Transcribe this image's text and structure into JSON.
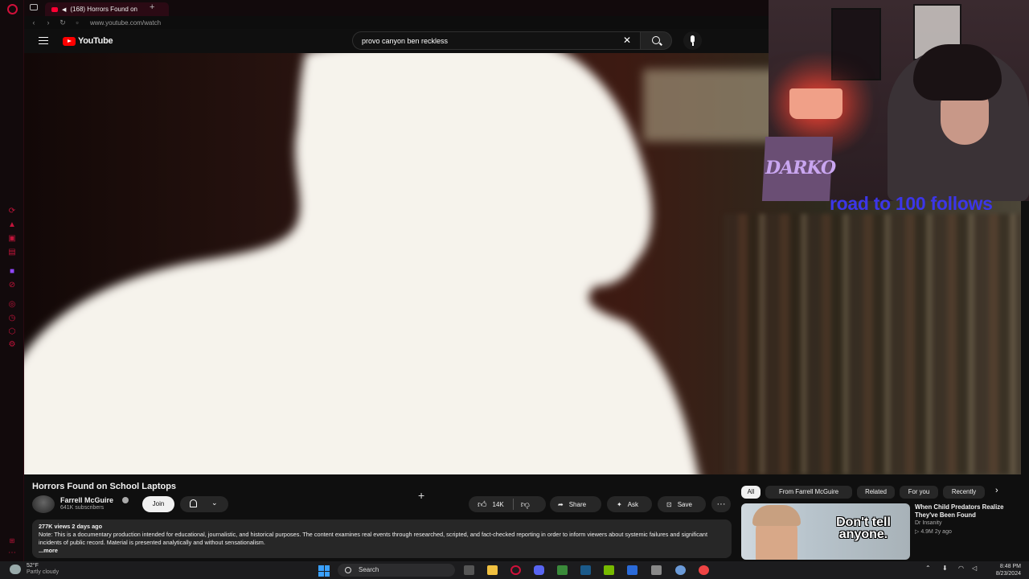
{
  "browser": {
    "tab_title": "(168) Horrors Found on",
    "new_tab_label": "+",
    "url": "www.youtube.com/watch"
  },
  "youtube": {
    "logo_text": "YouTube",
    "search_value": "provo canyon ben reckless"
  },
  "overlay": {
    "darko_label": "DARKO",
    "goal_text": "road to 100 follows"
  },
  "video": {
    "title": "Horrors Found on School Laptops",
    "channel": "Farrell McGuire",
    "subscribers": "641K subscribers",
    "join_label": "Join",
    "likes": "14K",
    "share_label": "Share",
    "ask_label": "Ask",
    "save_label": "Save",
    "more_label": "···"
  },
  "description": {
    "meta": "277K views  2 days ago",
    "text": "Note: This is a documentary production intended for educational, journalistic, and historical purposes. The content examines real events through researched, scripted, and fact-checked reporting in order to inform viewers about systemic failures and significant incidents of public record. Material is presented analytically and without sensationalism.",
    "more_label": "...more"
  },
  "chips": [
    {
      "label": "All"
    },
    {
      "label": "From Farrell McGuire"
    },
    {
      "label": "Related"
    },
    {
      "label": "For you"
    },
    {
      "label": "Recently"
    }
  ],
  "recommended": {
    "thumb_text": "Don't tell anyone.",
    "title": "When Child Predators Realize They've Been Found",
    "channel": "Dr Insanity",
    "meta": "▷ 4.9M  2y ago"
  },
  "taskbar": {
    "temperature": "52°F",
    "weather": "Partly cloudy",
    "search_label": "Search",
    "time": "8:48 PM",
    "date": "8/23/2024"
  },
  "colors": {
    "youtube_red": "#ff0000",
    "opera_red": "#d0103a",
    "overlay_blue": "#3c36e8",
    "darko_purple": "#c9a6f0"
  },
  "icons": [
    "opera-icon",
    "hamburger-icon",
    "search-icon",
    "mic-icon",
    "close-icon",
    "bell-icon",
    "like-icon",
    "dislike-icon",
    "share-icon",
    "ask-icon",
    "save-icon",
    "windows-start-icon"
  ]
}
